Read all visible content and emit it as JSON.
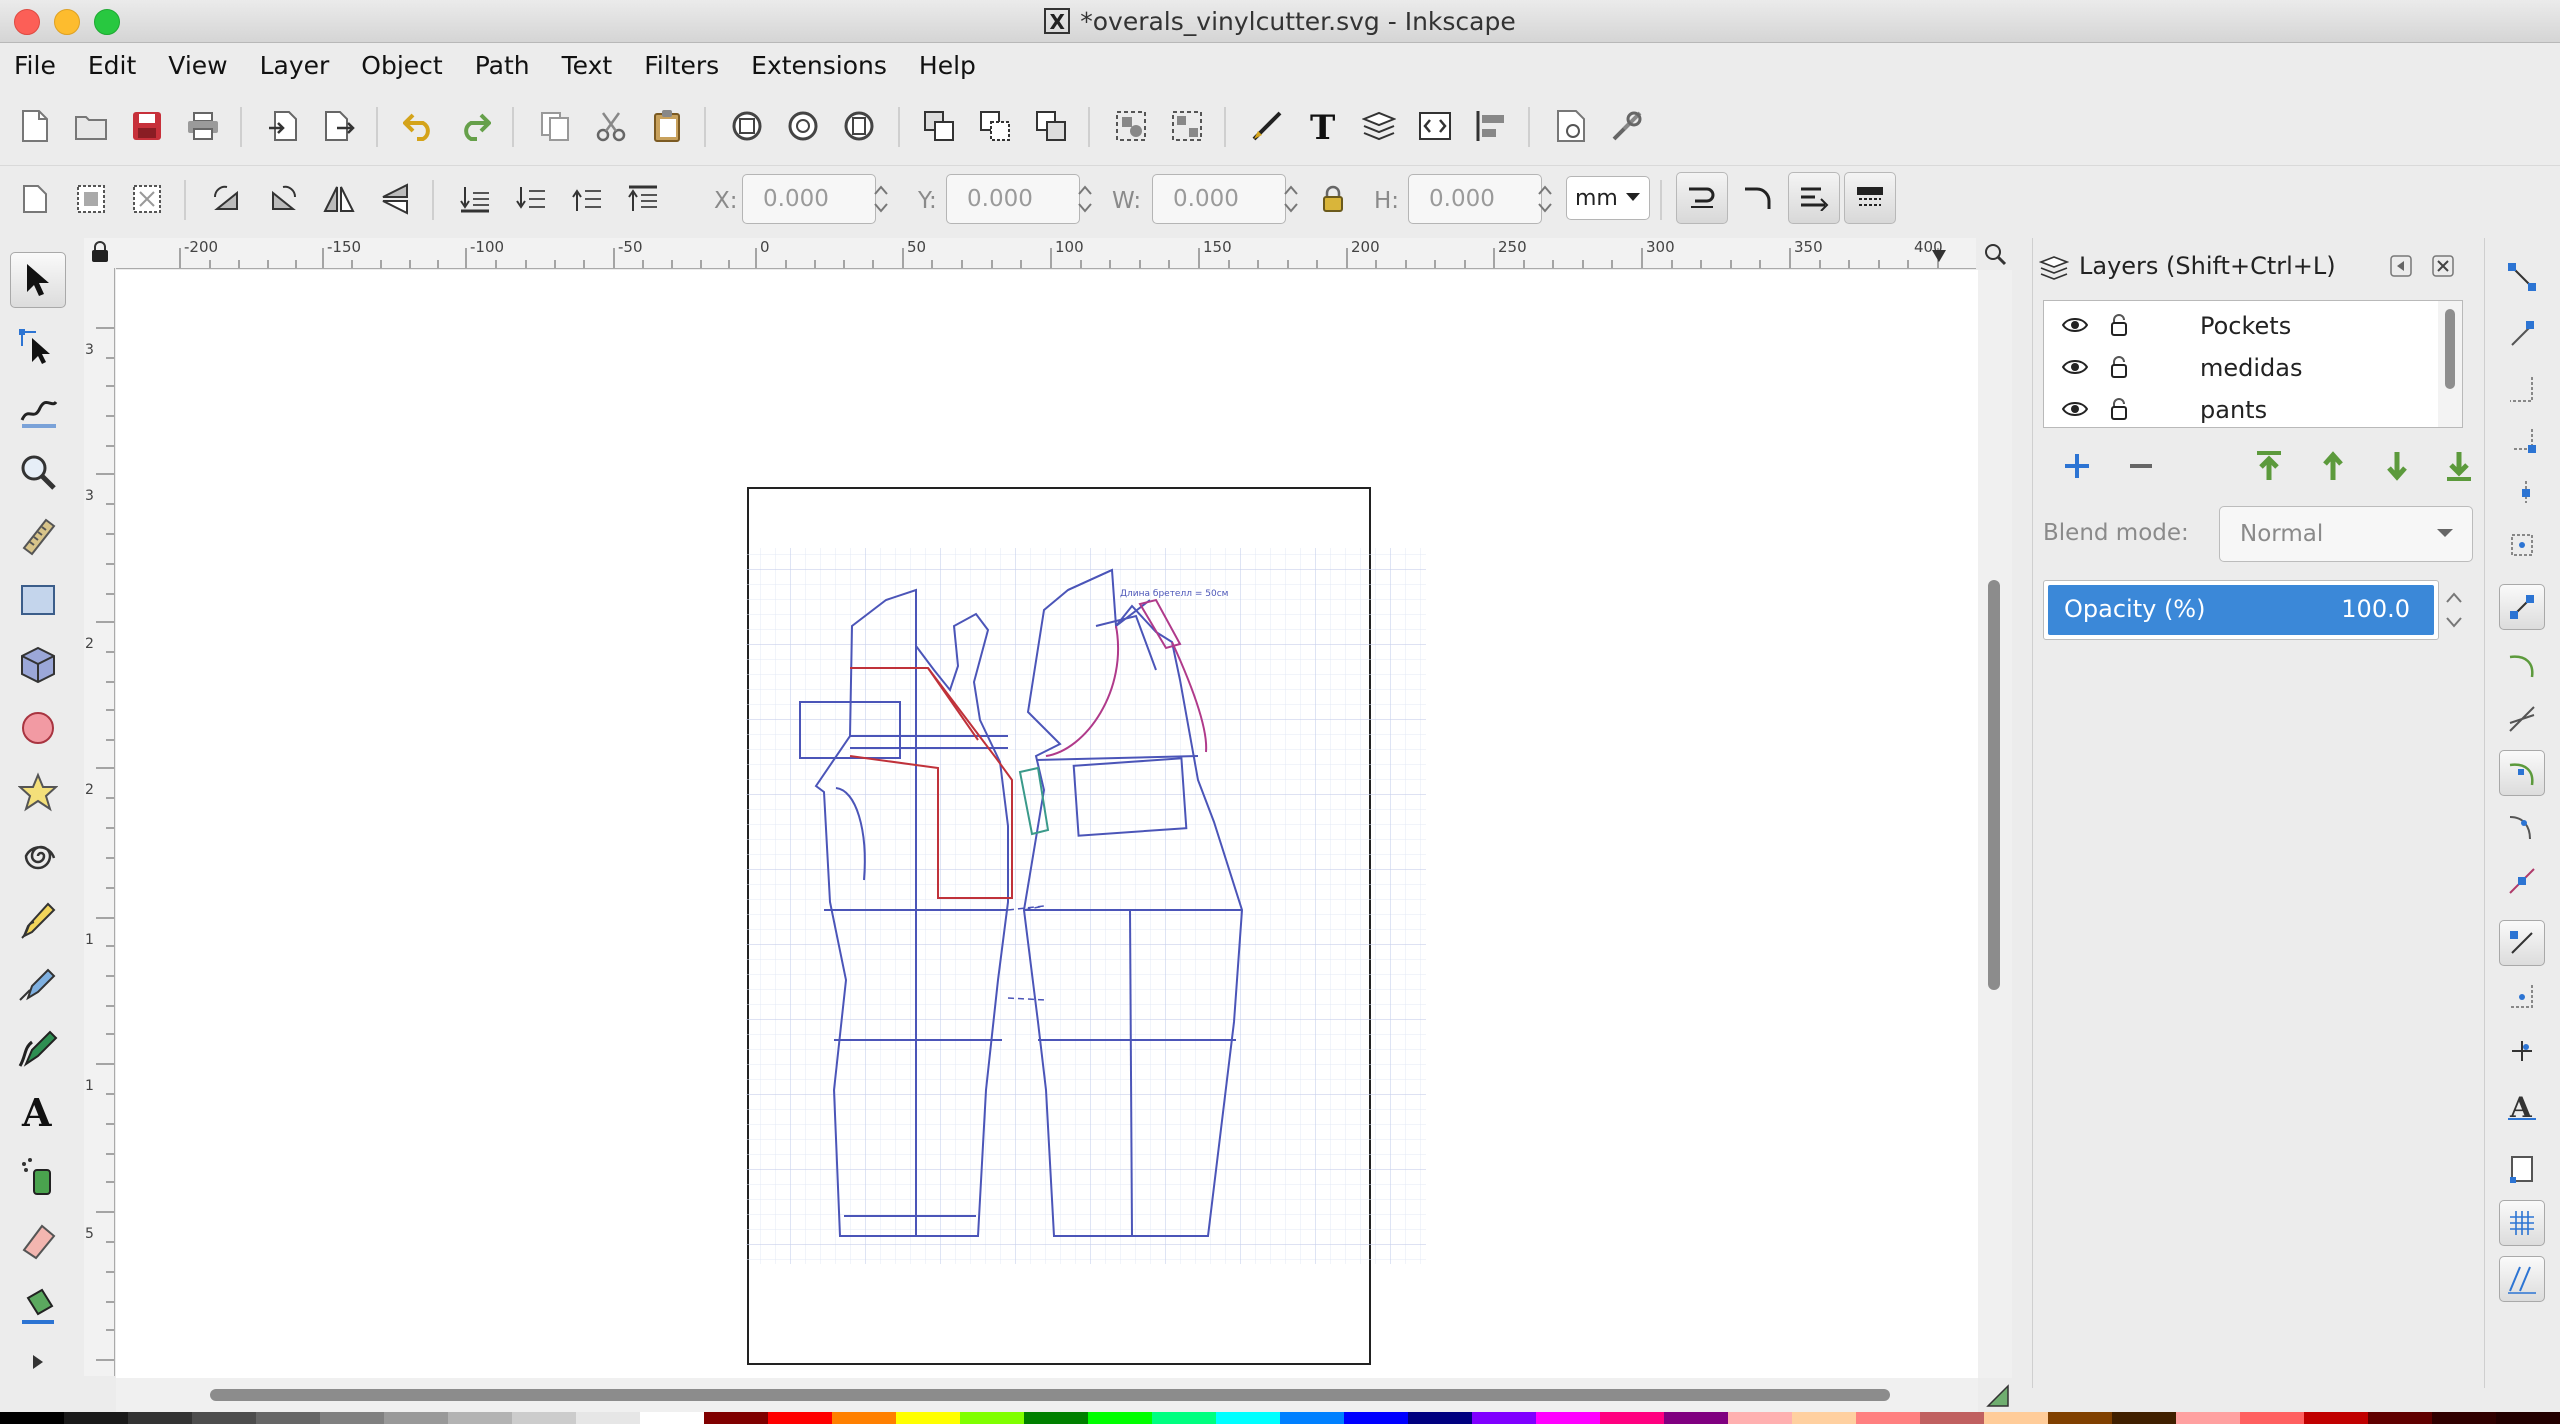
{
  "window": {
    "title": "*overals_vinylcutter.svg - Inkscape",
    "x_badge": "X"
  },
  "menu": [
    "File",
    "Edit",
    "View",
    "Layer",
    "Object",
    "Path",
    "Text",
    "Filters",
    "Extensions",
    "Help"
  ],
  "toolbar": {
    "commands": [
      "new-document",
      "open-file",
      "save-file",
      "print",
      "import",
      "export",
      "undo",
      "redo",
      "copy",
      "cut",
      "paste",
      "zoom-selection",
      "zoom-drawing",
      "zoom-page",
      "duplicate",
      "clone",
      "unlink-clone",
      "group",
      "ungroup",
      "node-editor",
      "text-font",
      "layers",
      "xml-editor",
      "align-distribute",
      "document-properties",
      "preferences"
    ]
  },
  "controls": {
    "x_label": "X:",
    "x_value": "0.000",
    "y_label": "Y:",
    "y_value": "0.000",
    "w_label": "W:",
    "w_value": "0.000",
    "h_label": "H:",
    "h_value": "0.000",
    "unit": "mm"
  },
  "tools": [
    "selector",
    "node",
    "tweak",
    "zoom",
    "measure",
    "rectangle",
    "3d-box",
    "ellipse",
    "star",
    "spiral",
    "pencil",
    "pen",
    "calligraphy",
    "text",
    "spray",
    "eraser",
    "paint-bucket"
  ],
  "ruler": {
    "h_labels": [
      "-200",
      "-150",
      "-100",
      "-50",
      "0",
      "50",
      "100",
      "150",
      "200",
      "250",
      "300",
      "350",
      "400"
    ],
    "v_labels": [
      "3",
      "3",
      "2",
      "2",
      "1",
      "1",
      "5"
    ]
  },
  "layers_panel": {
    "title": "Layers (Shift+Ctrl+L)",
    "layers": [
      "Pockets",
      "medidas",
      "pants"
    ],
    "blend_label": "Blend mode:",
    "blend_value": "Normal",
    "opacity_label": "Opacity (%)",
    "opacity_value": "100.0",
    "opacity_fraction": 1.0
  },
  "canvas_text": {
    "top_note": "Длина бретелл = 50см"
  },
  "colors": {
    "accent": "#3b88d8",
    "pattern_blue": "#4b55b8",
    "pattern_red": "#c0323a",
    "grid": "#dfe5f5"
  }
}
